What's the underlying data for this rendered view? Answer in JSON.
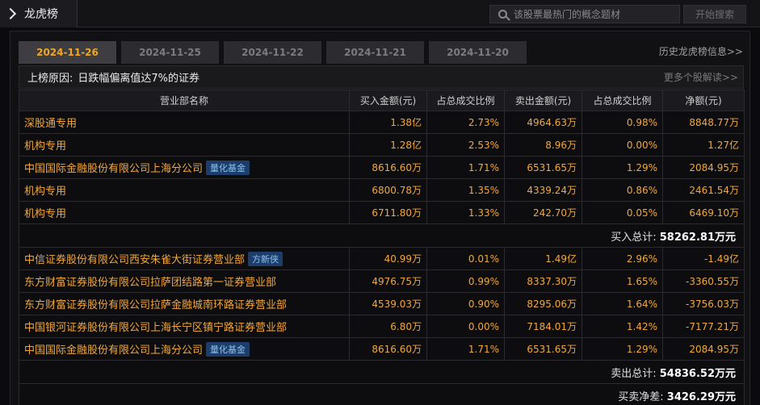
{
  "app": {
    "title": "龙虎榜"
  },
  "search": {
    "placeholder": "该股票最热门的概念题材",
    "button": "开始搜索"
  },
  "tabs": [
    "2024-11-26",
    "2024-11-25",
    "2024-11-22",
    "2024-11-21",
    "2024-11-20"
  ],
  "history_link": "历史龙虎榜信息>>",
  "reason": {
    "label": "上榜原因:",
    "text": "日跌幅偏离值达7%的证券",
    "more": "更多个股解读>>"
  },
  "columns": [
    "营业部名称",
    "买入金额(元)",
    "占总成交比例",
    "卖出金额(元)",
    "占总成交比例",
    "净额(元)"
  ],
  "buy_rows": [
    {
      "name": "深股通专用",
      "badge": "",
      "buy": "1.38亿",
      "buy_pct": "2.73%",
      "sell": "4964.63万",
      "sell_pct": "0.98%",
      "net": "8848.77万"
    },
    {
      "name": "机构专用",
      "badge": "",
      "buy": "1.28亿",
      "buy_pct": "2.53%",
      "sell": "8.96万",
      "sell_pct": "0.00%",
      "net": "1.27亿"
    },
    {
      "name": "中国国际金融股份有限公司上海分公司",
      "badge": "量化基金",
      "buy": "8616.60万",
      "buy_pct": "1.71%",
      "sell": "6531.65万",
      "sell_pct": "1.29%",
      "net": "2084.95万"
    },
    {
      "name": "机构专用",
      "badge": "",
      "buy": "6800.78万",
      "buy_pct": "1.35%",
      "sell": "4339.24万",
      "sell_pct": "0.86%",
      "net": "2461.54万"
    },
    {
      "name": "机构专用",
      "badge": "",
      "buy": "6711.80万",
      "buy_pct": "1.33%",
      "sell": "242.70万",
      "sell_pct": "0.05%",
      "net": "6469.10万"
    }
  ],
  "buy_total": {
    "label": "买入总计:",
    "value": "58262.81万元"
  },
  "sell_rows": [
    {
      "name": "中信证券股份有限公司西安朱雀大街证券营业部",
      "badge": "方新侠",
      "buy": "40.99万",
      "buy_pct": "0.01%",
      "sell": "1.49亿",
      "sell_pct": "2.96%",
      "net": "-1.49亿"
    },
    {
      "name": "东方财富证券股份有限公司拉萨团结路第一证券营业部",
      "badge": "",
      "buy": "4976.75万",
      "buy_pct": "0.99%",
      "sell": "8337.30万",
      "sell_pct": "1.65%",
      "net": "-3360.55万"
    },
    {
      "name": "东方财富证券股份有限公司拉萨金融城南环路证券营业部",
      "badge": "",
      "buy": "4539.03万",
      "buy_pct": "0.90%",
      "sell": "8295.06万",
      "sell_pct": "1.64%",
      "net": "-3756.03万"
    },
    {
      "name": "中国银河证券股份有限公司上海长宁区镇宁路证券营业部",
      "badge": "",
      "buy": "6.80万",
      "buy_pct": "0.00%",
      "sell": "7184.01万",
      "sell_pct": "1.42%",
      "net": "-7177.21万"
    },
    {
      "name": "中国国际金融股份有限公司上海分公司",
      "badge": "量化基金",
      "buy": "8616.60万",
      "buy_pct": "1.71%",
      "sell": "6531.65万",
      "sell_pct": "1.29%",
      "net": "2084.95万"
    }
  ],
  "sell_total": {
    "label": "卖出总计:",
    "value": "54836.52万元"
  },
  "net_total": {
    "label": "买卖净差:",
    "value": "3426.29万元"
  },
  "colors": {
    "accent": "#f0a623",
    "value": "#f2a83a",
    "badge_bg": "#1d3e6a",
    "badge_text": "#8cc0f0"
  }
}
